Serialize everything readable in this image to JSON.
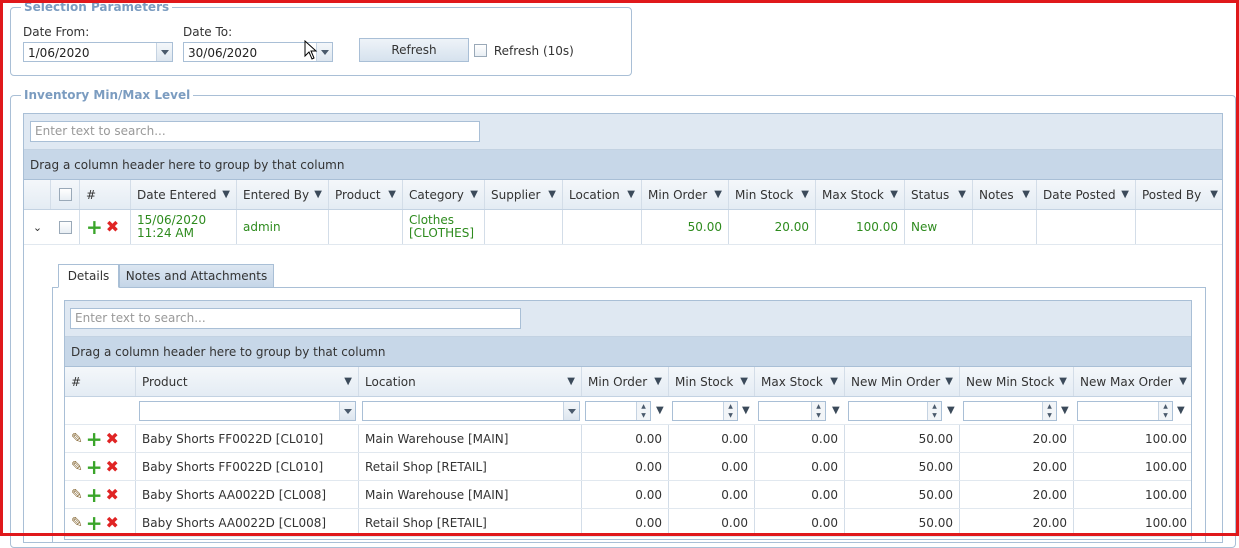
{
  "selection": {
    "legend": "Selection Parameters",
    "date_from_label": "Date From:",
    "date_from_value": "1/06/2020",
    "date_to_label": "Date To:",
    "date_to_value": "30/06/2020",
    "refresh_label": "Refresh",
    "auto_refresh_label": "Refresh (10s)"
  },
  "inventory": {
    "legend": "Inventory Min/Max Level",
    "search_placeholder": "Enter text to search...",
    "group_hint": "Drag a column header here to group by that column",
    "columns": [
      "#",
      "Date Entered",
      "Entered By",
      "Product",
      "Category",
      "Supplier",
      "Location",
      "Min Order",
      "Min Stock",
      "Max Stock",
      "Status",
      "Notes",
      "Date Posted",
      "Posted By"
    ],
    "row": {
      "date_entered_line1": "15/06/2020",
      "date_entered_line2": "11:24 AM",
      "entered_by": "admin",
      "product": "",
      "category_line1": "Clothes",
      "category_line2": "[CLOTHES]",
      "supplier": "",
      "location": "",
      "min_order": "50.00",
      "min_stock": "20.00",
      "max_stock": "100.00",
      "status": "New",
      "notes": "",
      "date_posted": "",
      "posted_by": ""
    }
  },
  "detail": {
    "tabs": [
      "Details",
      "Notes and Attachments"
    ],
    "search_placeholder": "Enter text to search...",
    "group_hint": "Drag a column header here to group by that column",
    "columns": [
      "#",
      "Product",
      "Location",
      "Min Order",
      "Min Stock",
      "Max Stock",
      "New Min Order",
      "New Min Stock",
      "New Max Order"
    ],
    "rows": [
      {
        "product": "Baby Shorts FF0022D [CL010]",
        "location": "Main Warehouse [MAIN]",
        "min_order": "0.00",
        "min_stock": "0.00",
        "max_stock": "0.00",
        "new_min_order": "50.00",
        "new_min_stock": "20.00",
        "new_max_order": "100.00"
      },
      {
        "product": "Baby Shorts FF0022D [CL010]",
        "location": "Retail Shop [RETAIL]",
        "min_order": "0.00",
        "min_stock": "0.00",
        "max_stock": "0.00",
        "new_min_order": "50.00",
        "new_min_stock": "20.00",
        "new_max_order": "100.00"
      },
      {
        "product": "Baby Shorts AA0022D [CL008]",
        "location": "Main Warehouse [MAIN]",
        "min_order": "0.00",
        "min_stock": "0.00",
        "max_stock": "0.00",
        "new_min_order": "50.00",
        "new_min_stock": "20.00",
        "new_max_order": "100.00"
      },
      {
        "product": "Baby Shorts AA0022D [CL008]",
        "location": "Retail Shop [RETAIL]",
        "min_order": "0.00",
        "min_stock": "0.00",
        "max_stock": "0.00",
        "new_min_order": "50.00",
        "new_min_stock": "20.00",
        "new_max_order": "100.00"
      }
    ]
  },
  "colors": {
    "accent_border": "#e0181b",
    "legend": "#7b9cc0",
    "green_text": "#2e8b1e",
    "header_bg": "#dfe8f2"
  }
}
